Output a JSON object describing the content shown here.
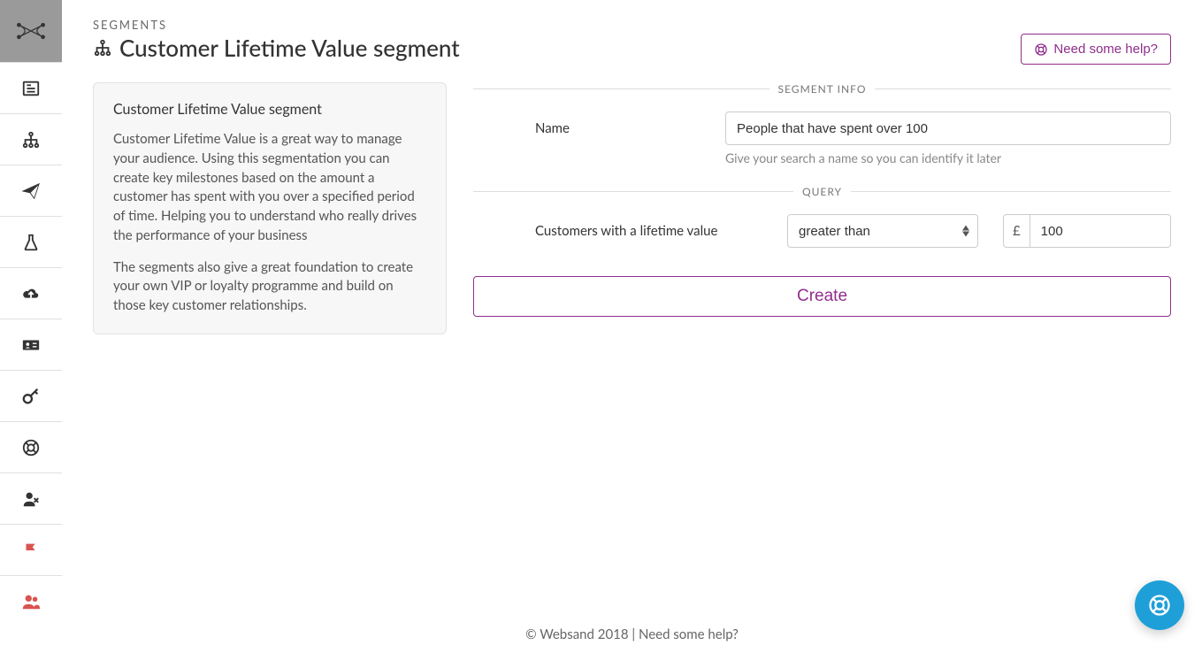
{
  "breadcrumb": "SEGMENTS",
  "page_title": "Customer Lifetime Value segment",
  "help_button_label": "Need some help?",
  "info_card": {
    "title": "Customer Lifetime Value segment",
    "paragraph_1": "Customer Lifetime Value is a great way to manage your audience. Using this segmentation you can create key milestones based on the amount a customer has spent with you over a specified period of time. Helping you to understand who really drives the performance of your business",
    "paragraph_2": "The segments also give a great foundation to create your own VIP or loyalty programme and build on those key customer relationships."
  },
  "segment_info": {
    "legend": "SEGMENT INFO",
    "name_label": "Name",
    "name_value": "People that have spent over 100",
    "name_hint": "Give your search a name so you can identify it later"
  },
  "query": {
    "legend": "QUERY",
    "field_label": "Customers with a lifetime value",
    "comparator_selected": "greater than",
    "currency_symbol": "£",
    "amount_value": "100"
  },
  "create_button_label": "Create",
  "footer_text": "© Websand 2018 | Need some help?",
  "sidebar": {
    "items": [
      {
        "name": "logo"
      },
      {
        "name": "dashboard"
      },
      {
        "name": "segments"
      },
      {
        "name": "send"
      },
      {
        "name": "experiments"
      },
      {
        "name": "uploads"
      },
      {
        "name": "cards"
      },
      {
        "name": "keys"
      },
      {
        "name": "support"
      },
      {
        "name": "remove-user"
      },
      {
        "name": "flag"
      },
      {
        "name": "team"
      }
    ]
  }
}
